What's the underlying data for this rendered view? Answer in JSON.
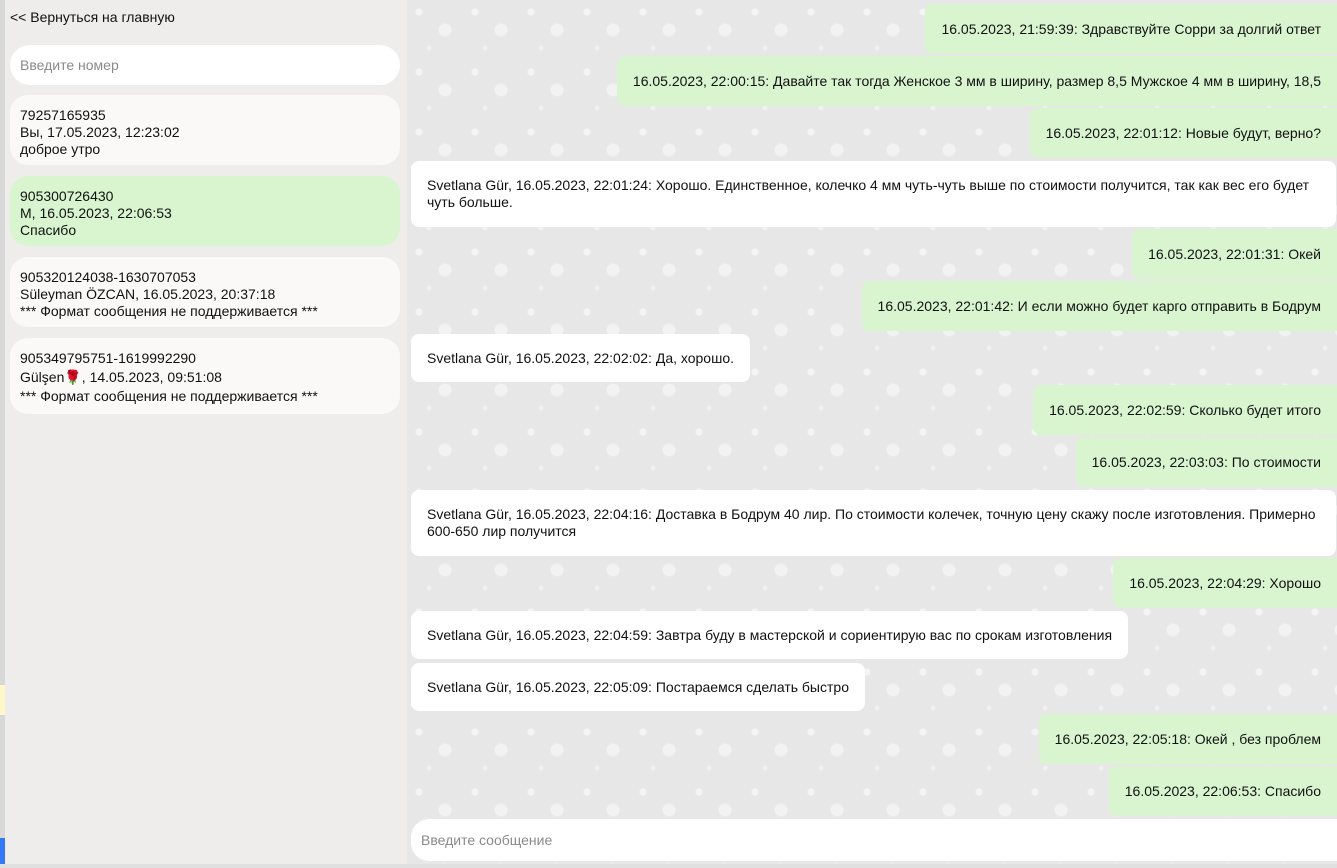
{
  "sidebar": {
    "back_link": "<< Вернуться на главную",
    "search_placeholder": "Введите номер",
    "chats": [
      {
        "number": "79257165935",
        "meta": "Вы, 17.05.2023, 12:23:02",
        "preview": "доброе утро",
        "active": false
      },
      {
        "number": "905300726430",
        "meta": "M, 16.05.2023, 22:06:53",
        "preview": "Спасибо",
        "active": true
      },
      {
        "number": "905320124038-1630707053",
        "meta": "Süleyman ÖZCAN, 16.05.2023, 20:37:18",
        "preview": "*** Формат сообщения не поддерживается ***",
        "active": false
      },
      {
        "number": "905349795751-1619992290",
        "meta": "Gülşen🌹, 14.05.2023, 09:51:08",
        "preview": "*** Формат сообщения не поддерживается ***",
        "active": false
      }
    ]
  },
  "messages": [
    {
      "dir": "out",
      "text": "16.05.2023, 21:59:39: Здравствуйте Сорри за долгий ответ"
    },
    {
      "dir": "out",
      "text": "16.05.2023, 22:00:15: Давайте так тогда Женское 3 мм в ширину, размер 8,5 Мужское 4 мм в ширину, 18,5"
    },
    {
      "dir": "out",
      "text": "16.05.2023, 22:01:12: Новые будут, верно?"
    },
    {
      "dir": "in",
      "text": "Svetlana Gür, 16.05.2023, 22:01:24: Хорошо. Единственное, колечко 4 мм чуть-чуть выше по стоимости получится, так как вес его будет чуть больше."
    },
    {
      "dir": "out",
      "text": "16.05.2023, 22:01:31: Окей"
    },
    {
      "dir": "out",
      "text": "16.05.2023, 22:01:42: И если можно будет карго отправить в Бодрум"
    },
    {
      "dir": "in",
      "text": "Svetlana Gür, 16.05.2023, 22:02:02: Да, хорошо."
    },
    {
      "dir": "out",
      "text": "16.05.2023, 22:02:59: Сколько будет итого"
    },
    {
      "dir": "out",
      "text": "16.05.2023, 22:03:03: По стоимости"
    },
    {
      "dir": "in",
      "text": "Svetlana Gür, 16.05.2023, 22:04:16: Доставка в Бодрум 40 лир. По стоимости колечек, точную цену скажу после изготовления. Примерно 600-650 лир получится"
    },
    {
      "dir": "out",
      "text": "16.05.2023, 22:04:29: Хорошо"
    },
    {
      "dir": "in",
      "text": "Svetlana Gür, 16.05.2023, 22:04:59: Завтра буду в мастерской и сориентирую вас по срокам изготовления"
    },
    {
      "dir": "in",
      "text": "Svetlana Gür, 16.05.2023, 22:05:09: Постараемся сделать быстро"
    },
    {
      "dir": "out",
      "text": "16.05.2023, 22:05:18: Окей , без проблем"
    },
    {
      "dir": "out",
      "text": "16.05.2023, 22:06:53: Спасибо"
    }
  ],
  "composer": {
    "placeholder": "Введите сообщение"
  },
  "colors": {
    "outgoing_bubble": "#d9f5d0",
    "incoming_bubble": "#ffffff",
    "active_chat": "#d9f5d0",
    "sidebar_bg": "#efedec"
  }
}
